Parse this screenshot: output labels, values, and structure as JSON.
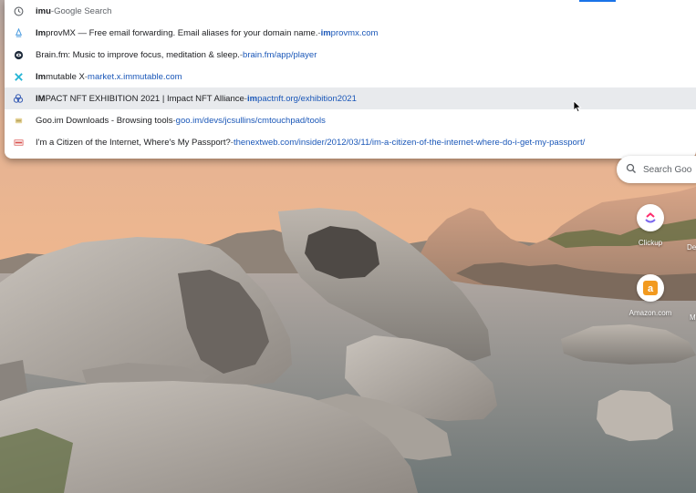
{
  "omnibox": {
    "suggestions": [
      {
        "icon": "history-clock-icon",
        "bold": "imu",
        "rest": "",
        "sep": " - ",
        "source": "Google Search",
        "url_bold": "",
        "url_rest": ""
      },
      {
        "icon": "improvmx-favicon-icon",
        "bold": "Im",
        "rest": "provMX — Free email forwarding. Email aliases for your domain name.",
        "sep": " - ",
        "source": "",
        "url_bold": "im",
        "url_rest": "provmx.com"
      },
      {
        "icon": "brainfm-favicon-icon",
        "bold": "",
        "rest": "Brain.fm: Music to improve focus, meditation & sleep.",
        "sep": " - ",
        "source": "",
        "url_bold": "",
        "url_rest": "brain.fm/app/player"
      },
      {
        "icon": "immutable-x-favicon-icon",
        "bold": "Im",
        "rest": "mutable X",
        "sep": " - ",
        "source": "",
        "url_bold": "",
        "url_rest": "market.x.immutable.com"
      },
      {
        "icon": "impact-nft-favicon-icon",
        "bold": "IM",
        "rest": "PACT NFT EXHIBITION 2021 | Impact NFT Alliance",
        "sep": " - ",
        "source": "",
        "url_bold": "im",
        "url_rest": "pactnft.org/exhibition2021"
      },
      {
        "icon": "gooim-favicon-icon",
        "bold": "",
        "rest": "Goo.im Downloads - Browsing tools",
        "sep": " - ",
        "source": "",
        "url_bold": "",
        "url_rest": "goo.im/devs/jcsullins/cmtouchpad/tools"
      },
      {
        "icon": "tnw-favicon-icon",
        "bold": "",
        "rest": "I'm a Citizen of the Internet, Where's My Passport?",
        "sep": " - ",
        "source": "",
        "url_bold": "",
        "url_rest": "thenextweb.com/insider/2012/03/11/im-a-citizen-of-the-internet-where-do-i-get-my-passport/"
      }
    ],
    "selected_index": 4
  },
  "ntp": {
    "search_placeholder": "Search Goo",
    "tiles": [
      {
        "label": "Clickup",
        "icon": "clickup-icon"
      },
      {
        "label": "Amazon.com",
        "icon": "amazon-icon"
      }
    ],
    "edge_labels": [
      "De",
      "M"
    ]
  },
  "colors": {
    "url_blue": "#1a57b8",
    "selected_row": "#e8eaed",
    "amazon_orange": "#f29a1f"
  }
}
